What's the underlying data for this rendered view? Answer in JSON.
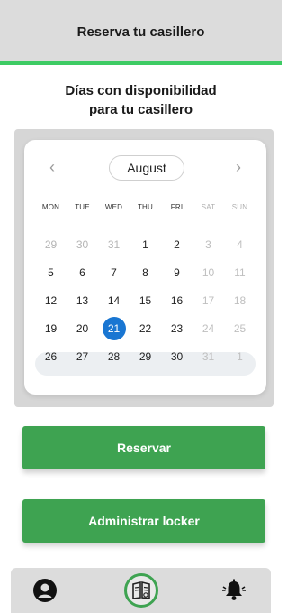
{
  "header": {
    "title": "Reserva tu casillero",
    "accent_color": "#3ecb64"
  },
  "subtitle": {
    "line1": "Días con disponibilidad",
    "line2": "para tu casillero"
  },
  "calendar": {
    "month": "August",
    "prev_icon": "chevron-left-icon",
    "next_icon": "chevron-right-icon",
    "weekdays": [
      "MON",
      "TUE",
      "WED",
      "THU",
      "FRI",
      "SAT",
      "SUN"
    ],
    "weeks": [
      [
        "29",
        "30",
        "31",
        "1",
        "2",
        "3",
        "4"
      ],
      [
        "5",
        "6",
        "7",
        "8",
        "9",
        "10",
        "11"
      ],
      [
        "12",
        "13",
        "14",
        "15",
        "16",
        "17",
        "18"
      ],
      [
        "19",
        "20",
        "21",
        "22",
        "23",
        "24",
        "25"
      ],
      [
        "26",
        "27",
        "28",
        "29",
        "30",
        "31",
        "1"
      ]
    ],
    "selected_day": "21",
    "selected_color": "#1976d2"
  },
  "actions": {
    "reserve_label": "Reservar",
    "manage_label": "Administrar locker",
    "button_color": "#3ea351"
  },
  "bottom_nav": {
    "items": [
      {
        "icon": "user-circle-icon"
      },
      {
        "icon": "locker-book-icon",
        "active": true
      },
      {
        "icon": "bell-alert-icon"
      }
    ]
  }
}
